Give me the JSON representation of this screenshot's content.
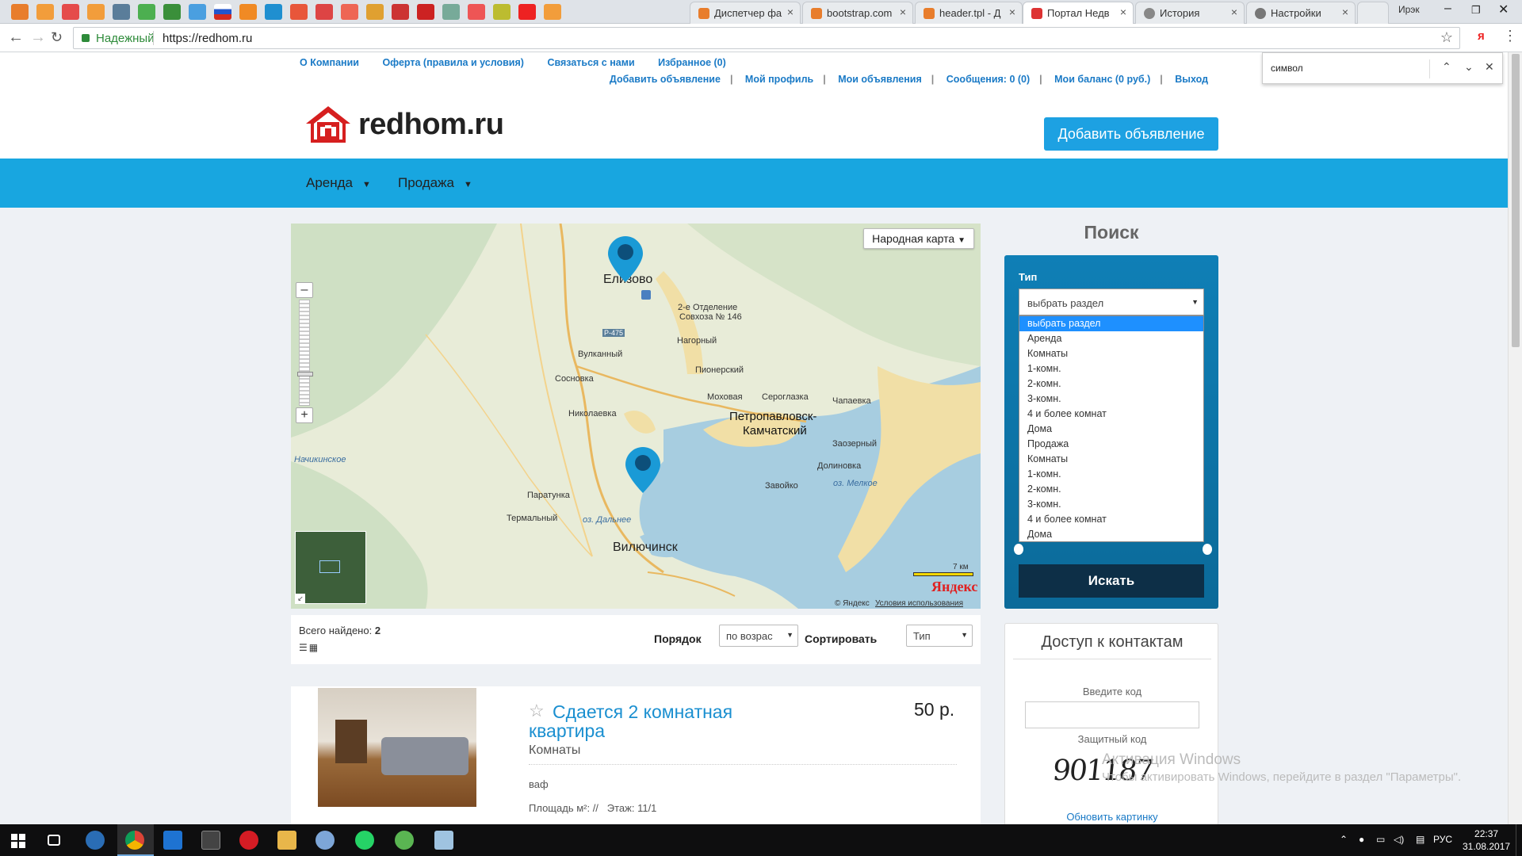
{
  "browser": {
    "tabs": [
      {
        "label": "Диспетчер фа",
        "active": false
      },
      {
        "label": "bootstrap.com",
        "active": false
      },
      {
        "label": "header.tpl - Д",
        "active": false
      },
      {
        "label": "Портал Недв",
        "active": true
      },
      {
        "label": "История",
        "active": false
      },
      {
        "label": "Настройки",
        "active": false
      }
    ],
    "user_name": "Ирэк",
    "secure_label": "Надежный",
    "url": "https://redhom.ru"
  },
  "find_bar": {
    "query": "символ"
  },
  "top_links": [
    "О Компании",
    "Оферта (правила и условия)",
    "Связаться с нами",
    "Избранное (0)"
  ],
  "user_links": [
    "Добавить объявление",
    "Мой профиль",
    "Мои объявления",
    "Сообщения: 0 (0)",
    "Мои баланс (0 руб.)",
    "Выход"
  ],
  "logo_text": "redhom.ru",
  "add_button": "Добавить объявление",
  "nav": [
    {
      "label": "Аренда"
    },
    {
      "label": "Продажа"
    }
  ],
  "map": {
    "layer_select": "Народная карта",
    "labels": {
      "elizovo": "Елизово",
      "otdelenie": "2-е Отделение",
      "sovkhoz": "Совхоза № 146",
      "road": "Р-475",
      "nagorny": "Нагорный",
      "vulkanny": "Вулканный",
      "pionersky": "Пионерский",
      "sosnovka": "Сосновка",
      "mokhovaya": "Моховая",
      "serogazka": "Сероглазка",
      "chapaevka": "Чапаевка",
      "nikolaevka": "Николаевка",
      "pk1": "Петропавловск-",
      "pk2": "Камчатский",
      "zaozerny": "Заозерный",
      "nachikinskoe": "Начикинское",
      "dolinovka": "Долиновка",
      "paratunka": "Паратунка",
      "zavoyko": "Завойко",
      "melkoe": "оз. Мелкое",
      "termalny": "Термальный",
      "dalnee": "оз. Дальнее",
      "vilyuchinsk": "Вилючинск"
    },
    "scale": "7 км",
    "brand": "Яндекс",
    "copyright": "© Яндекс",
    "terms": "Условия использования"
  },
  "results": {
    "found_label": "Всего найдено:",
    "found_count": "2",
    "order_label": "Порядок",
    "order_value": "по возрас",
    "sort_label": "Сортировать",
    "sort_value": "Тип"
  },
  "listing": {
    "title": "Сдается 2 комнатная квартира",
    "price": "50 р.",
    "category": "Комнаты",
    "description": "ваф",
    "area": "Площадь м²: //",
    "floor": "Этаж: 11/1"
  },
  "search": {
    "heading": "Поиск",
    "type_label": "Тип",
    "type_value": "выбрать раздел",
    "options": [
      "выбрать раздел",
      "Аренда",
      "Комнаты",
      "1-комн.",
      "2-комн.",
      "3-комн.",
      "4 и более комнат",
      "Дома",
      "Продажа",
      "Комнаты",
      "1-комн.",
      "2-комн.",
      "3-комн.",
      "4 и более комнат",
      "Дома"
    ],
    "button": "Искать"
  },
  "contacts": {
    "heading": "Доступ к контактам",
    "code_label": "Введите код",
    "protect_label": "Защитный код",
    "captcha": "901187",
    "refresh": "Обновить картинку"
  },
  "watermark": {
    "line1": "Активация Windows",
    "line2": "Чтобы активировать Windows, перейдите в раздел \"Параметры\"."
  },
  "taskbar": {
    "lang": "РУС",
    "time": "22:37",
    "date": "31.08.2017"
  },
  "colors": {
    "brand_blue": "#18a6e0",
    "link_blue": "#1a7ac6",
    "search_panel": "#0f7fb6",
    "search_button": "#0d2f47"
  }
}
